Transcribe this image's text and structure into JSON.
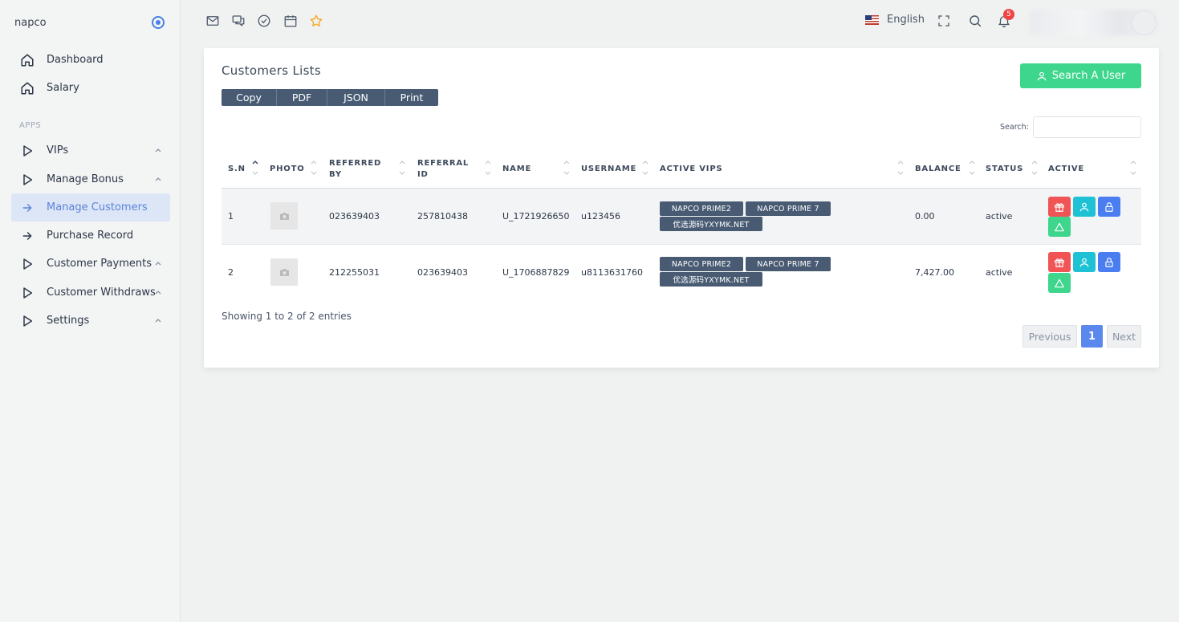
{
  "sidebar": {
    "brand": "napco",
    "section_apps": "APPS",
    "items": [
      {
        "label": "Dashboard",
        "icon": "home-icon"
      },
      {
        "label": "Salary",
        "icon": "home-icon"
      },
      {
        "label": "VIPs",
        "icon": "play-icon",
        "has_chevron": true
      },
      {
        "label": "Manage Bonus",
        "icon": "play-icon",
        "has_chevron": true
      },
      {
        "label": "Manage Customers",
        "icon": "arrow-right-icon",
        "active": true
      },
      {
        "label": "Purchase Record",
        "icon": "arrow-right-icon"
      },
      {
        "label": "Customer Payments",
        "icon": "play-icon",
        "has_chevron": true
      },
      {
        "label": "Customer Withdraws",
        "icon": "play-icon",
        "has_chevron": true
      },
      {
        "label": "Settings",
        "icon": "play-icon",
        "has_chevron": true
      }
    ]
  },
  "topbar": {
    "icons": [
      "mail-icon",
      "chat-icon",
      "check-circle-icon",
      "calendar-icon",
      "star-icon"
    ],
    "language": "English",
    "notification_count": "5"
  },
  "card": {
    "title": "Customers Lists",
    "search_user_label": "Search A User",
    "export_buttons": [
      "Copy",
      "PDF",
      "JSON",
      "Print"
    ],
    "search_label": "Search:",
    "search_value": ""
  },
  "table": {
    "columns": [
      "S.N",
      "PHOTO",
      "REFERRED BY",
      "REFERRAL ID",
      "NAME",
      "USERNAME",
      "ACTIVE VIPS",
      "BALANCE",
      "STATUS",
      "ACTIVE"
    ],
    "rows": [
      {
        "sn": "1",
        "referred_by": "023639403",
        "referral_id": "257810438",
        "name": "U_1721926650",
        "username": "u123456",
        "vips": [
          "NAPCO PRIME2",
          "NAPCO PRIME 7",
          "优选源码YXYMK.NET"
        ],
        "balance": "0.00",
        "status": "active"
      },
      {
        "sn": "2",
        "referred_by": "212255031",
        "referral_id": "023639403",
        "name": "U_1706887829",
        "username": "u8113631760",
        "vips": [
          "NAPCO PRIME2",
          "NAPCO PRIME 7",
          "优选源码YXYMK.NET"
        ],
        "balance": "7,427.00",
        "status": "active"
      }
    ]
  },
  "pagination": {
    "info": "Showing 1 to 2 of 2 entries",
    "previous": "Previous",
    "current": "1",
    "next": "Next"
  },
  "colors": {
    "accent_green": "#3dd68c",
    "badge_dark": "#485b73",
    "active_nav_bg": "#dde6f6",
    "active_nav_text": "#5a82d8",
    "page_blue": "#5a88ec",
    "danger_red": "#f05454",
    "info_cyan": "#1fc2d4",
    "primary_blue": "#4a7ef0"
  }
}
